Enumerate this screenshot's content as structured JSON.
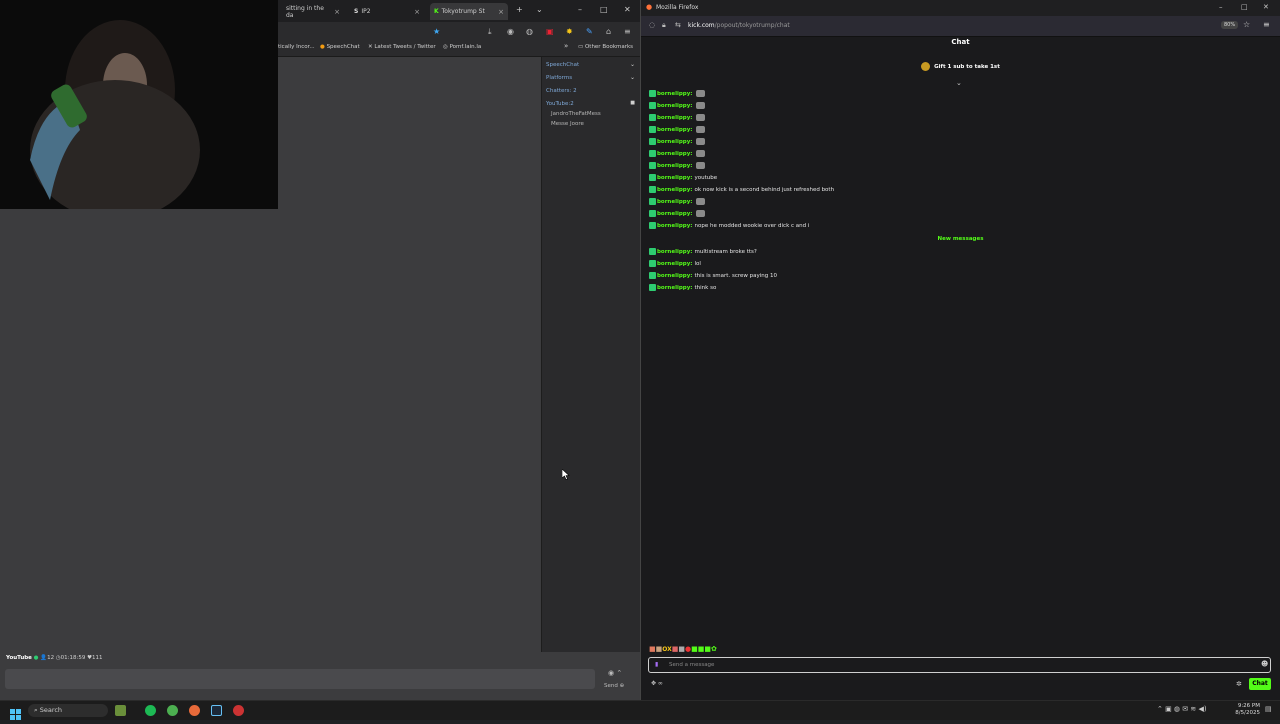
{
  "left_browser": {
    "tabs": [
      {
        "label": "sitting in the da",
        "active": false
      },
      {
        "label": "IP2",
        "active": false
      },
      {
        "label": "Tokyotrump St",
        "active": true
      }
    ],
    "new_tab": "+",
    "bookmarks": [
      "tically Incor...",
      "SpeechChat",
      "Latest Tweets / Twitter",
      "Pomf.lain.la"
    ],
    "bookmarks_more": "»",
    "other_bookmarks": "Other Bookmarks"
  },
  "side_panel": {
    "speechchat": "SpeechChat",
    "platforms": "Platforms",
    "chatters": "Chatters: 2",
    "youtube": "YouTube:2",
    "users": [
      "JandroTheFatMess",
      "Messe Joore"
    ]
  },
  "status_bar": {
    "platform": "YouTube",
    "viewers": "12",
    "uptime": "01:18:59",
    "likes": "111"
  },
  "send_label": "Send",
  "firefox": {
    "title": "Mozilla Firefox",
    "url_host": "kick.com",
    "url_path": "/popout/tokyotrump/chat",
    "zoom": "80%"
  },
  "chat": {
    "header": "Chat",
    "gift_text": "Gift 1 sub to take 1st",
    "new_messages": "New messages",
    "placeholder": "Send a message",
    "chat_button": "Chat",
    "messages_before": [
      {
        "user": "bornelippy:",
        "text": "",
        "emote": true
      },
      {
        "user": "bornelippy:",
        "text": "",
        "emote": true
      },
      {
        "user": "bornelippy:",
        "text": "",
        "emote": true
      },
      {
        "user": "bornelippy:",
        "text": "",
        "emote": true
      },
      {
        "user": "bornelippy:",
        "text": "",
        "emote": true
      },
      {
        "user": "bornelippy:",
        "text": "",
        "emote": true
      },
      {
        "user": "bornelippy:",
        "text": "",
        "emote": true
      },
      {
        "user": "bornelippy:",
        "text": "youtube",
        "emote": false
      },
      {
        "user": "bornelippy:",
        "text": "ok now kick is a second behind just refreshed both",
        "emote": false
      },
      {
        "user": "bornelippy:",
        "text": "",
        "emote": true
      },
      {
        "user": "bornelippy:",
        "text": "",
        "emote": true
      },
      {
        "user": "bornelippy:",
        "text": "nope he modded wookie over dick c and i",
        "emote": false
      }
    ],
    "messages_after": [
      {
        "user": "bornelippy:",
        "text": "multistream broke tts?",
        "emote": false
      },
      {
        "user": "bornelippy:",
        "text": "lol",
        "emote": false
      },
      {
        "user": "bornelippy:",
        "text": "this is smart. screw paying 10",
        "emote": false
      },
      {
        "user": "bornelippy:",
        "text": "think so",
        "emote": false
      }
    ]
  },
  "taskbar": {
    "search": "Search",
    "time": "9:26 PM",
    "date": "8/5/2025"
  },
  "colors": {
    "kick_green": "#53fc18",
    "panel_bg": "#3c3c3e",
    "chat_bg": "#1a1a1c"
  }
}
